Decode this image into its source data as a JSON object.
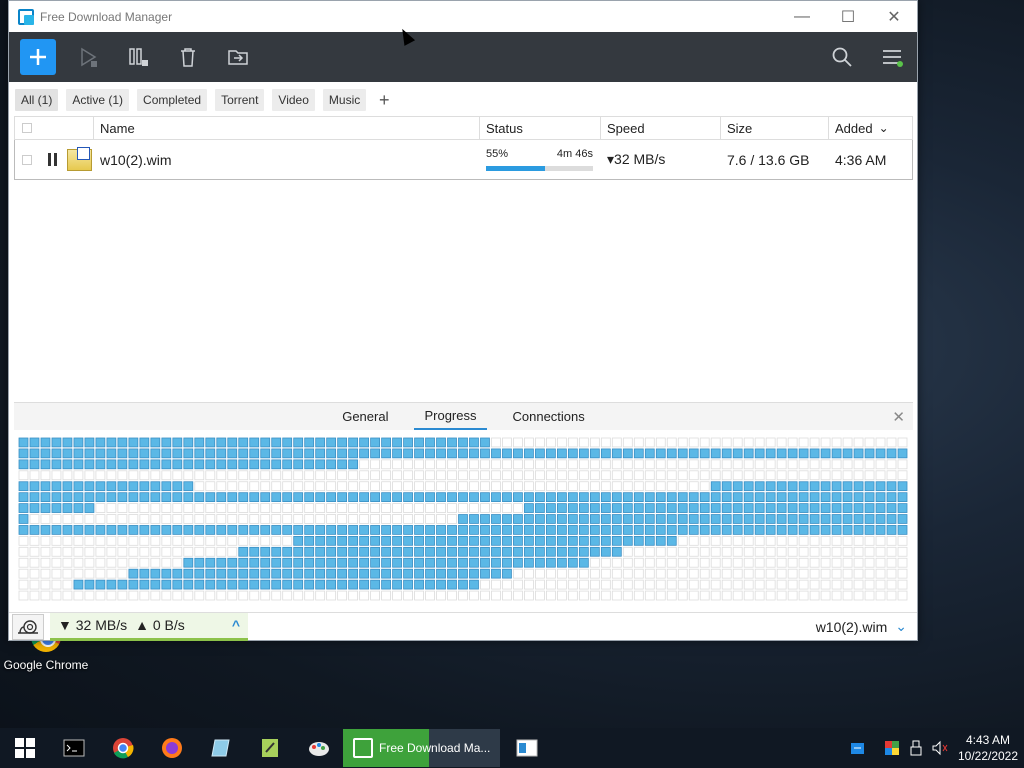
{
  "desktop": {
    "icon_label": "Google Chrome"
  },
  "window": {
    "title": "Free Download Manager",
    "controls": {
      "minimize": "—",
      "maximize": "☐",
      "close": "✕"
    }
  },
  "filters": [
    "All (1)",
    "Active (1)",
    "Completed",
    "Torrent",
    "Video",
    "Music"
  ],
  "filter_add": "+",
  "table": {
    "headers": {
      "name": "Name",
      "status": "Status",
      "speed": "Speed",
      "size": "Size",
      "added": "Added"
    },
    "sort_indicator": "⌄",
    "rows": [
      {
        "name": "w10(2).wim",
        "percent_label": "55%",
        "time_left": "4m 46s",
        "progress": 0.55,
        "speed": "▾32 MB/s",
        "size": "7.6 / 13.6 GB",
        "added": "4:36 AM"
      }
    ]
  },
  "panel": {
    "tabs": [
      "General",
      "Progress",
      "Connections"
    ],
    "active_tab": "Progress",
    "close": "✕",
    "pieces": {
      "columns": 81,
      "rows": 15,
      "colors": {
        "filled": "#5bb8e6",
        "filled_stroke": "#3b8fc4",
        "empty": "#ffffff",
        "empty_stroke": "#dcdcdc"
      },
      "filled_ranges": [
        [
          [
            0,
            43
          ]
        ],
        [
          [
            0,
            81
          ]
        ],
        [
          [
            0,
            31
          ]
        ],
        [
          [
            5,
            5
          ]
        ],
        [
          [
            0,
            16
          ],
          [
            63,
            81
          ]
        ],
        [
          [
            0,
            81
          ]
        ],
        [
          [
            0,
            7
          ],
          [
            46,
            81
          ]
        ],
        [
          [
            0,
            1
          ],
          [
            40,
            81
          ]
        ],
        [
          [
            0,
            81
          ]
        ],
        [
          [
            25,
            60
          ]
        ],
        [
          [
            20,
            55
          ]
        ],
        [
          [
            15,
            52
          ]
        ],
        [
          [
            10,
            45
          ]
        ],
        [
          [
            5,
            42
          ]
        ],
        [
          [
            0,
            0
          ]
        ]
      ]
    }
  },
  "statusbar": {
    "down": "▼ 32 MB/s",
    "up": "▲ 0 B/s",
    "expand": "^",
    "file": "w10(2).wim",
    "chevron": "⌄"
  },
  "taskbar": {
    "active_app": "Free Download Ma...",
    "active_progress": 0.55,
    "time": "4:43 AM",
    "date": "10/22/2022"
  }
}
